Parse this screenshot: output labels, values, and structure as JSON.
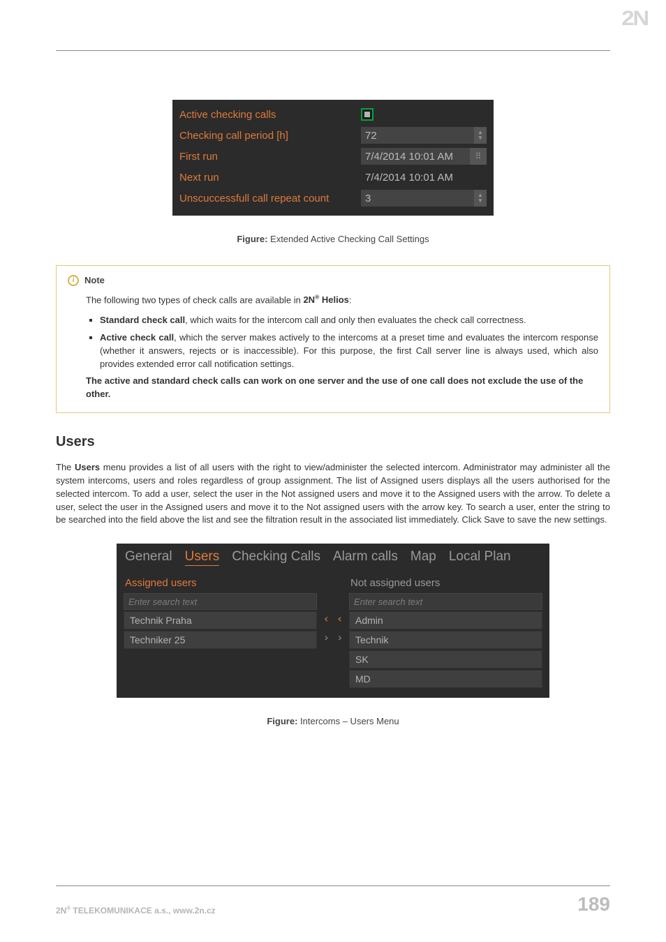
{
  "logo": "2N",
  "settings": {
    "r0": {
      "label": "Active checking calls"
    },
    "r1": {
      "label": "Checking call period [h]",
      "value": "72"
    },
    "r2": {
      "label": "First run",
      "value": "7/4/2014 10:01 AM"
    },
    "r3": {
      "label": "Next run",
      "value": "7/4/2014 10:01 AM"
    },
    "r4": {
      "label": "Unscuccessfull call repeat count",
      "value": "3"
    }
  },
  "fig1": {
    "bold": "Figure:",
    "text": " Extended Active Checking Call Settings"
  },
  "note": {
    "title": "Note",
    "intro_a": "The following two types of check calls are available in ",
    "intro_b": "2N",
    "intro_c": " Helios",
    "intro_d": ":",
    "li1_b": "Standard check call",
    "li1_t": ", which waits for the intercom call and only then evaluates the check call correctness.",
    "li2_b": "Active check call",
    "li2_t": ", which the server makes actively to the intercoms at a preset time and evaluates the intercom response (whether it answers, rejects or is inaccessible). For this purpose, the first Call server line is always used, which also provides extended error call notification settings.",
    "closing": "The active and standard check calls can work on one server and the use of one call does not exclude the use of the other."
  },
  "users_h": "Users",
  "users_para_a": "The ",
  "users_para_b": "Users",
  "users_para_c": " menu provides a list of all users with the right to view/administer the selected intercom. Administrator may administer all the system intercoms, users and roles regardless of group assignment. The list of Assigned users displays all the users authorised for the selected intercom. To add a user, select the user in the Not assigned users and move it to the Assigned users with the arrow. To delete a user, select the user in the Assigned users and move it to the Not assigned users with the arrow key. To search a user, enter the string to be searched into the field above the list and see the filtration result in the associated list immediately. Click Save to save the new settings.",
  "tabs": {
    "t0": "General",
    "t1": "Users",
    "t2": "Checking Calls",
    "t3": "Alarm calls",
    "t4": "Map",
    "t5": "Local Plan"
  },
  "assigned": {
    "title": "Assigned users",
    "search": "Enter search text",
    "items": [
      "Technik Praha",
      "Techniker 25"
    ]
  },
  "notassigned": {
    "title": "Not assigned users",
    "search": "Enter search text",
    "items": [
      "Admin",
      "Technik",
      "SK",
      "MD"
    ]
  },
  "arrows": {
    "left": "‹ ‹",
    "right": "› ›"
  },
  "fig2": {
    "bold": "Figure:",
    "text": " Intercoms – Users Menu"
  },
  "footer": {
    "left_a": "2N",
    "left_b": " TELEKOMUNIKACE a.s., www.2n.cz",
    "page": "189"
  }
}
